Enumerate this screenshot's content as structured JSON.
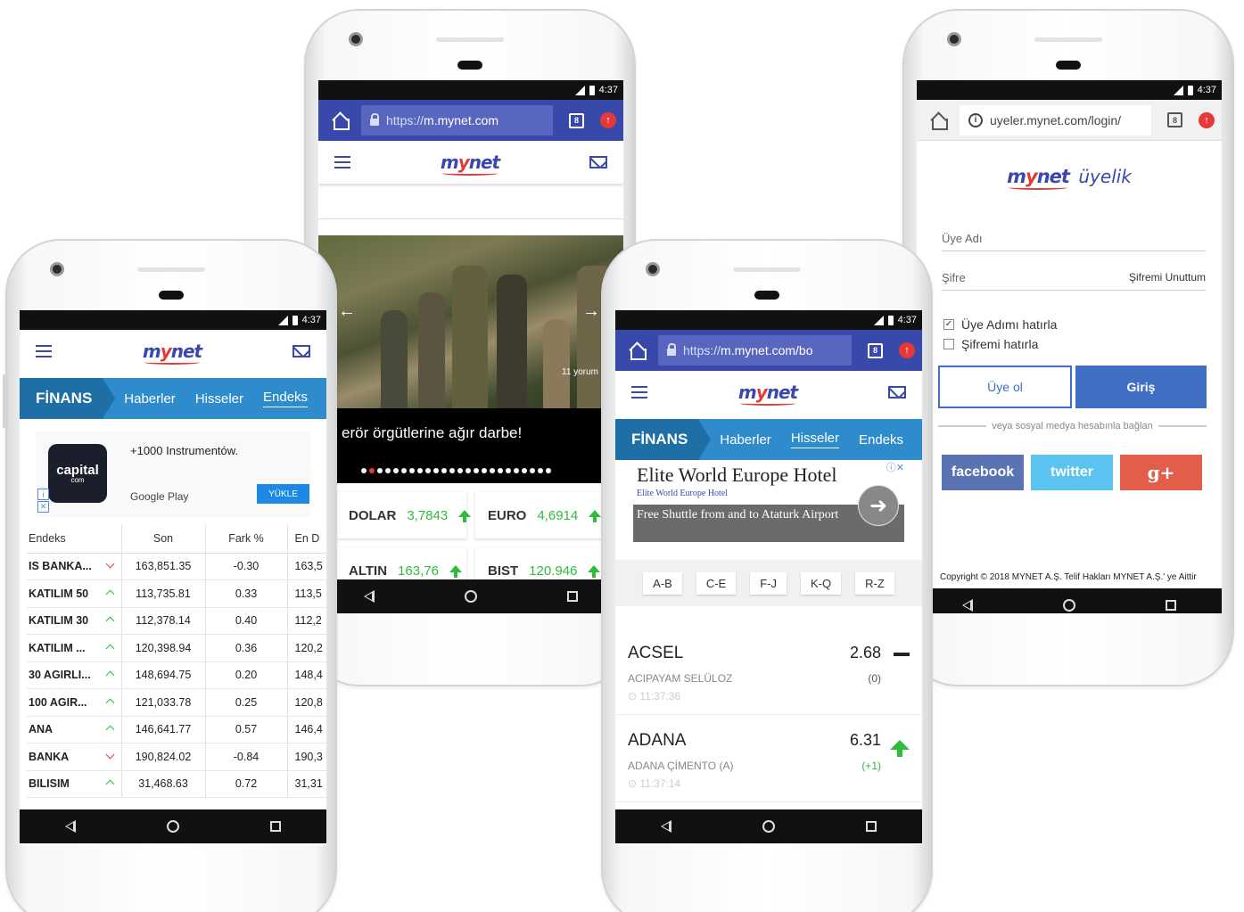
{
  "status_time": "4:37",
  "brand": {
    "logo": "mynet"
  },
  "phone_a": {
    "finans": "FİNANS",
    "tabs": [
      "Haberler",
      "Hisseler",
      "Endeks"
    ],
    "ad": {
      "app": "capital",
      "app_sub": "com",
      "title": "+1000 Instrumentów.",
      "store": "Google Play",
      "button": "YÜKLE"
    },
    "table_headers": [
      "Endeks",
      "Son",
      "Fark %",
      "En D"
    ],
    "rows": [
      {
        "name": "IS BANKA...",
        "dir": "down",
        "son": "163,851.35",
        "fark": "-0.30",
        "en": "163,5"
      },
      {
        "name": "KATILIM 50",
        "dir": "up",
        "son": "113,735.81",
        "fark": "0.33",
        "en": "113,5"
      },
      {
        "name": "KATILIM 30",
        "dir": "up",
        "son": "112,378.14",
        "fark": "0.40",
        "en": "112,2"
      },
      {
        "name": "KATILIM ...",
        "dir": "up",
        "son": "120,398.94",
        "fark": "0.36",
        "en": "120,2"
      },
      {
        "name": "30 AGIRLI...",
        "dir": "up",
        "son": "148,694.75",
        "fark": "0.20",
        "en": "148,4"
      },
      {
        "name": "100 AGIR...",
        "dir": "up",
        "son": "121,033.78",
        "fark": "0.25",
        "en": "120,8"
      },
      {
        "name": "ANA",
        "dir": "up",
        "son": "146,641.77",
        "fark": "0.57",
        "en": "146,4"
      },
      {
        "name": "BANKA",
        "dir": "down",
        "son": "190,824.02",
        "fark": "-0.84",
        "en": "190,3"
      },
      {
        "name": "BILISIM",
        "dir": "up",
        "son": "31,468.63",
        "fark": "0.72",
        "en": "31,31"
      }
    ]
  },
  "phone_b": {
    "url_prefix": "https://",
    "url_host": "m.mynet.com",
    "tab_count": "8",
    "comments": "11 yorum",
    "headline": "erör örgütlerine ağır darbe!",
    "rates": [
      {
        "label": "DOLAR",
        "value": "3,7843"
      },
      {
        "label": "EURO",
        "value": "4,6914"
      },
      {
        "label": "ALTIN",
        "value": "163,76"
      },
      {
        "label": "BIST",
        "value": "120.946"
      }
    ]
  },
  "phone_c": {
    "url_prefix": "https://",
    "url_host": "m.mynet.com/bo",
    "tab_count": "8",
    "finans": "FİNANS",
    "tabs": [
      "Haberler",
      "Hisseler",
      "Endeks"
    ],
    "ad": {
      "title": "Elite World Europe Hotel",
      "sub": "Elite World Europe Hotel",
      "text": "Free Shuttle from and to Ataturk Airport"
    },
    "alpha": [
      "A-B",
      "C-E",
      "F-J",
      "K-Q",
      "R-Z"
    ],
    "stocks": [
      {
        "sym": "ACSEL",
        "full": "ACIPAYAM SELÜLOZ",
        "time": "11:37:36",
        "price": "2.68",
        "change": "(0)"
      },
      {
        "sym": "ADANA",
        "full": "ADANA ÇİMENTO (A)",
        "time": "11:37:14",
        "price": "6.31",
        "change": "(+1)"
      }
    ]
  },
  "phone_d": {
    "url": "uyeler.mynet.com/login/",
    "tab_count": "8",
    "uyelik": "üyelik",
    "username_placeholder": "Üye Adı",
    "password_label": "Şifre",
    "forgot": "Şifremi Unuttum",
    "remember_user": "Üye Adımı hatırla",
    "remember_pass": "Şifremi hatırla",
    "signup": "Üye ol",
    "login": "Giriş",
    "or_social": "veya sosyal medya hesabınla bağlan",
    "facebook": "facebook",
    "twitter": "twitter",
    "gplus": "g+",
    "copyright": "Copyright © 2018 MYNET A.Ş. Telif Hakları MYNET A.Ş.' ye Aittir"
  },
  "colors": {
    "brand_blue": "#3949ab",
    "finans_blue": "#2f8ccc",
    "up_green": "#2ebd3a",
    "down_red": "#e53935"
  }
}
